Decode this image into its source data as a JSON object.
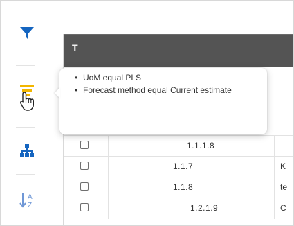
{
  "toolbar": {
    "items": [
      {
        "icon": "funnel-filter-icon",
        "color": "#1565c0",
        "active": false
      },
      {
        "icon": "filter-list-icon",
        "color": "#f2b600",
        "active": true
      },
      {
        "icon": "hierarchy-icon",
        "color": "#1565c0",
        "active": false
      },
      {
        "icon": "sort-az-icon",
        "color": "#6f97d6",
        "active": false
      }
    ]
  },
  "tooltip": {
    "items": [
      "UoM equal PLS",
      "Forecast method equal Current estimate"
    ]
  },
  "grid": {
    "header_fragment": "T",
    "rows": [
      {
        "code": "1.1.1.8",
        "name": ""
      },
      {
        "code": "1.1.7",
        "name": "K"
      },
      {
        "code": "1.1.8",
        "name": "te"
      },
      {
        "code": "1.2.1.9",
        "name": "C"
      }
    ]
  },
  "colors": {
    "header_bg": "#545454",
    "accent_blue": "#1565c0",
    "accent_yellow": "#f2b600"
  }
}
